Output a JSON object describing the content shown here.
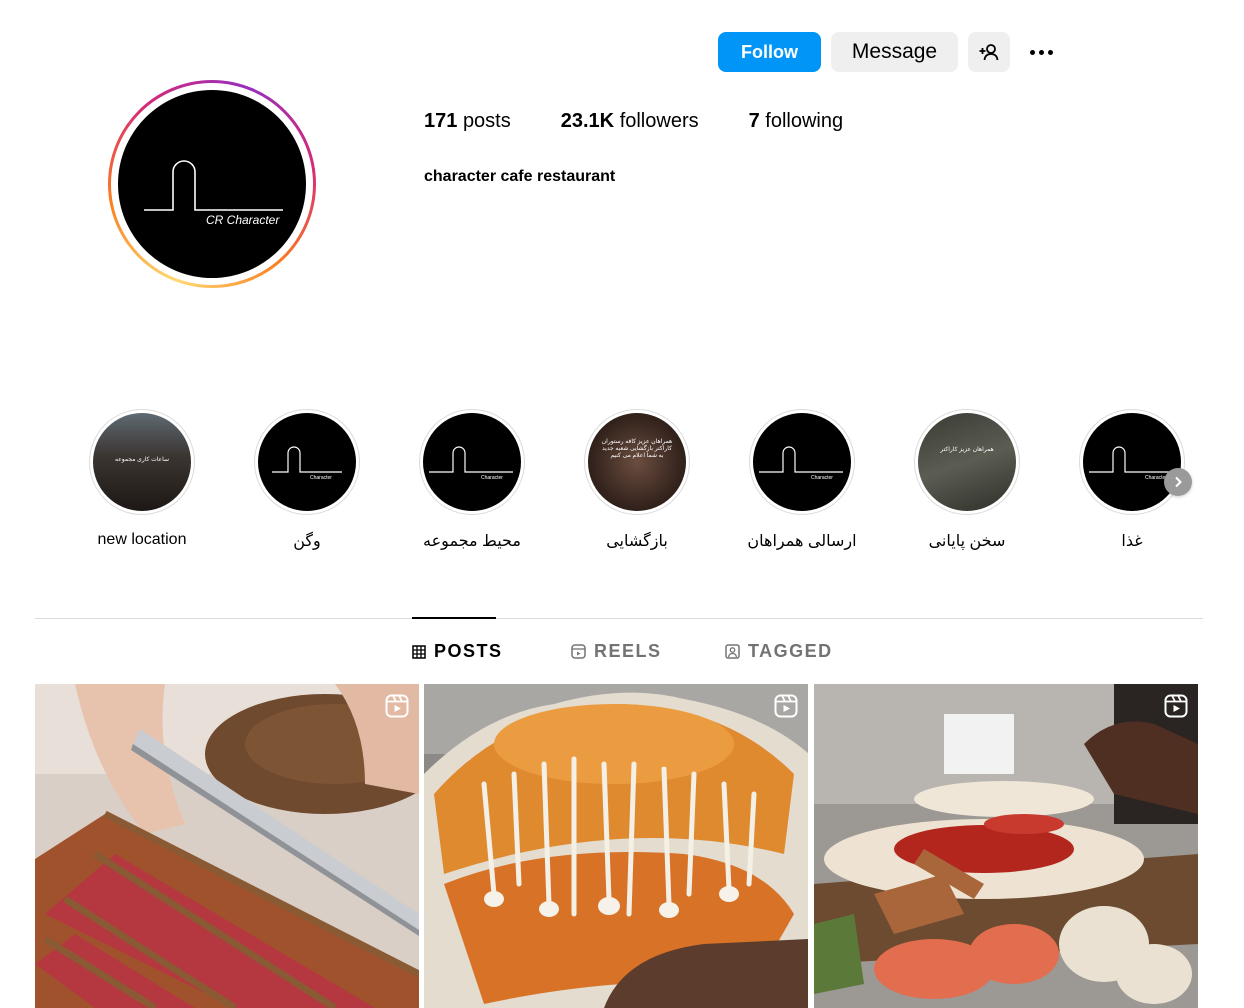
{
  "header": {
    "avatar_logo_text": "CR Character",
    "follow_label": "Follow",
    "message_label": "Message",
    "icons": {
      "add_user": "person-plus-icon",
      "more": "more-options-icon"
    }
  },
  "stats": {
    "posts_count": "171",
    "posts_label": "posts",
    "followers_count": "23.1K",
    "followers_label": "followers",
    "following_count": "7",
    "following_label": "following"
  },
  "bio": {
    "name": "character cafe restaurant"
  },
  "highlights": [
    {
      "label": "new location",
      "thumb_text": "ساعات کاری مجموعه"
    },
    {
      "label": "وگن",
      "thumb_text": "Character"
    },
    {
      "label": "محیط مجموعه",
      "thumb_text": "Character"
    },
    {
      "label": "بازگشایی",
      "thumb_text": "همراهان عزیز کافه رستوران کاراکتر بازگشایی شعبه جدید به شما اعلام می کنیم"
    },
    {
      "label": "ارسالی همراهان",
      "thumb_text": "Character"
    },
    {
      "label": "سخن پایانی",
      "thumb_text": "همراهان عزیز کاراکتر"
    },
    {
      "label": "غذا",
      "thumb_text": "Character"
    }
  ],
  "tabs": [
    {
      "label": "POSTS",
      "icon": "grid-icon",
      "active": true
    },
    {
      "label": "REELS",
      "icon": "reels-icon",
      "active": false
    },
    {
      "label": "TAGGED",
      "icon": "tagged-icon",
      "active": false
    }
  ],
  "posts": [
    {
      "subject": "sliced roast beef",
      "type_icon": "reel-icon"
    },
    {
      "subject": "cheese pull pizza",
      "type_icon": "reel-icon"
    },
    {
      "subject": "pizza preparation",
      "type_icon": "reel-icon"
    }
  ],
  "colors": {
    "accent": "#0095f6",
    "button_secondary": "#efefef",
    "muted_text": "#737373",
    "divider": "#dbdbdb"
  }
}
